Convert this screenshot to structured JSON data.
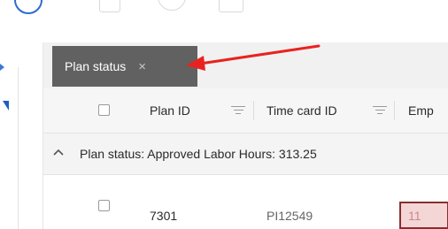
{
  "group_panel": {
    "chip_label": "Plan status",
    "chip_close": "×"
  },
  "columns": [
    {
      "label": "Plan ID"
    },
    {
      "label": "Time card ID"
    },
    {
      "label": "Emp"
    }
  ],
  "group_row": {
    "label": "Plan status: Approved Labor Hours: 313.25"
  },
  "rows": [
    {
      "plan_id": "7301",
      "time_card_id": "PI12549",
      "emp": "11"
    }
  ],
  "colors": {
    "chip_bg": "#616161",
    "arrow": "#e8231f",
    "accent": "#1f5fc4",
    "highlight_border": "#8b2e2e",
    "highlight_fill": "#f5d6d6"
  },
  "icons": {
    "chip_close": "close-icon",
    "group_toggle": "chevron-up-icon",
    "column_filter": "filter-icon"
  }
}
